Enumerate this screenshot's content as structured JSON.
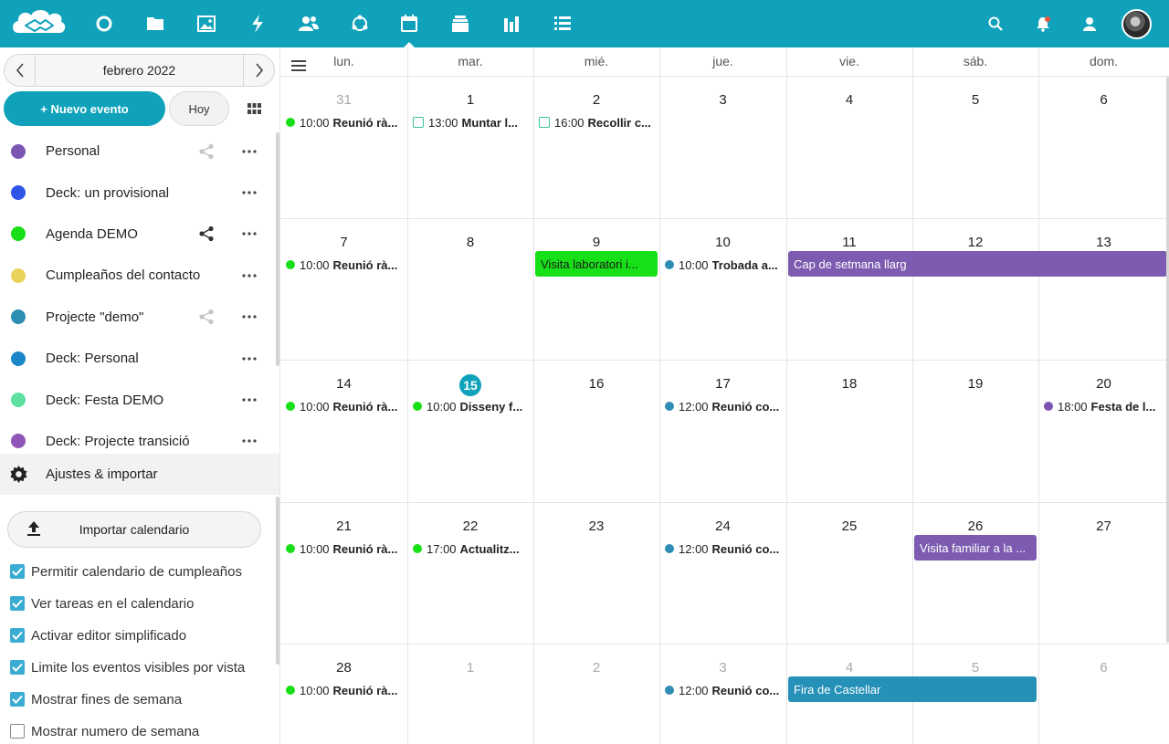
{
  "sidebar": {
    "month_label": "febrero 2022",
    "new_event_label": "+ Nuevo evento",
    "today_label": "Hoy",
    "calendars": [
      {
        "name": "Personal",
        "color": "#7c55b3",
        "share": "light"
      },
      {
        "name": "Deck: un provisional",
        "color": "#2e55e8",
        "share": "none"
      },
      {
        "name": "Agenda DEMO",
        "color": "#18e018",
        "share": "dark"
      },
      {
        "name": "Cumpleaños del contacto",
        "color": "#ead25a",
        "share": "none"
      },
      {
        "name": "Projecte \"demo\"",
        "color": "#2e8db3",
        "share": "light"
      },
      {
        "name": "Deck: Personal",
        "color": "#1a85c8",
        "share": "none"
      },
      {
        "name": "Deck: Festa DEMO",
        "color": "#5de0a0",
        "share": "none"
      },
      {
        "name": "Deck: Projecte transició",
        "color": "#9055b8",
        "share": "none"
      }
    ],
    "settings_label": "Ajustes & importar",
    "import_label": "Importar calendario",
    "options": [
      {
        "label": "Permitir calendario de cumpleaños",
        "checked": true
      },
      {
        "label": "Ver tareas en el calendario",
        "checked": true
      },
      {
        "label": "Activar editor simplificado",
        "checked": true
      },
      {
        "label": "Limite los eventos visibles por vista",
        "checked": true
      },
      {
        "label": "Mostrar fines de semana",
        "checked": true
      },
      {
        "label": "Mostrar numero de semana",
        "checked": false
      }
    ]
  },
  "calendar": {
    "weekdays": [
      "lun.",
      "mar.",
      "mié.",
      "jue.",
      "vie.",
      "sáb.",
      "dom."
    ],
    "weeks": [
      [
        "31",
        "1",
        "2",
        "3",
        "4",
        "5",
        "6"
      ],
      [
        "7",
        "8",
        "9",
        "10",
        "11",
        "12",
        "13"
      ],
      [
        "14",
        "15",
        "16",
        "17",
        "18",
        "19",
        "20"
      ],
      [
        "21",
        "22",
        "23",
        "24",
        "25",
        "26",
        "27"
      ],
      [
        "28",
        "1",
        "2",
        "3",
        "4",
        "5",
        "6"
      ]
    ],
    "other_month": [
      [
        0,
        0
      ],
      [
        4,
        1
      ],
      [
        4,
        2
      ],
      [
        4,
        3
      ],
      [
        4,
        4
      ],
      [
        4,
        5
      ],
      [
        4,
        6
      ]
    ],
    "today": [
      2,
      1
    ],
    "events": [
      {
        "w": 0,
        "d": 0,
        "kind": "dot",
        "color": "#18e018",
        "time": "10:00",
        "title": "Reunió rà..."
      },
      {
        "w": 0,
        "d": 1,
        "kind": "task",
        "time": "13:00",
        "title": "Muntar l..."
      },
      {
        "w": 0,
        "d": 2,
        "kind": "task",
        "time": "16:00",
        "title": "Recollir c..."
      },
      {
        "w": 1,
        "d": 0,
        "kind": "dot",
        "color": "#18e018",
        "time": "10:00",
        "title": "Reunió rà..."
      },
      {
        "w": 1,
        "d": 3,
        "kind": "dot",
        "color": "#2e8db3",
        "time": "10:00",
        "title": "Trobada a..."
      },
      {
        "w": 2,
        "d": 0,
        "kind": "dot",
        "color": "#18e018",
        "time": "10:00",
        "title": "Reunió rà..."
      },
      {
        "w": 2,
        "d": 1,
        "kind": "dot",
        "color": "#18e018",
        "time": "10:00",
        "title": "Disseny f..."
      },
      {
        "w": 2,
        "d": 3,
        "kind": "dot",
        "color": "#2e8db3",
        "time": "12:00",
        "title": "Reunió co..."
      },
      {
        "w": 2,
        "d": 6,
        "kind": "dot",
        "color": "#7c55b3",
        "time": "18:00",
        "title": "Festa de l..."
      },
      {
        "w": 3,
        "d": 0,
        "kind": "dot",
        "color": "#18e018",
        "time": "10:00",
        "title": "Reunió rà..."
      },
      {
        "w": 3,
        "d": 1,
        "kind": "dot",
        "color": "#18e018",
        "time": "17:00",
        "title": "Actualitz..."
      },
      {
        "w": 3,
        "d": 3,
        "kind": "dot",
        "color": "#2e8db3",
        "time": "12:00",
        "title": "Reunió co..."
      },
      {
        "w": 4,
        "d": 0,
        "kind": "dot",
        "color": "#18e018",
        "time": "10:00",
        "title": "Reunió rà..."
      },
      {
        "w": 4,
        "d": 3,
        "kind": "dot",
        "color": "#2e8db3",
        "time": "12:00",
        "title": "Reunió co..."
      }
    ],
    "bars": [
      {
        "w": 1,
        "d": 2,
        "span": 1,
        "bg": "#18e018",
        "fg": "#1a1a1a",
        "title": "Visita laboratori i..."
      },
      {
        "w": 1,
        "d": 4,
        "span": 3,
        "bg": "#7c5bb0",
        "fg": "#ffffff",
        "title": "Cap de setmana llarg"
      },
      {
        "w": 3,
        "d": 5,
        "span": 1,
        "bg": "#7c5bb0",
        "fg": "#ffffff",
        "title": "Visita familiar a la ..."
      },
      {
        "w": 4,
        "d": 4,
        "span": 2,
        "bg": "#2590b8",
        "fg": "#ffffff",
        "title": "Fira de Castellar"
      }
    ]
  },
  "colors": {
    "primary": "#0fa2ba"
  }
}
